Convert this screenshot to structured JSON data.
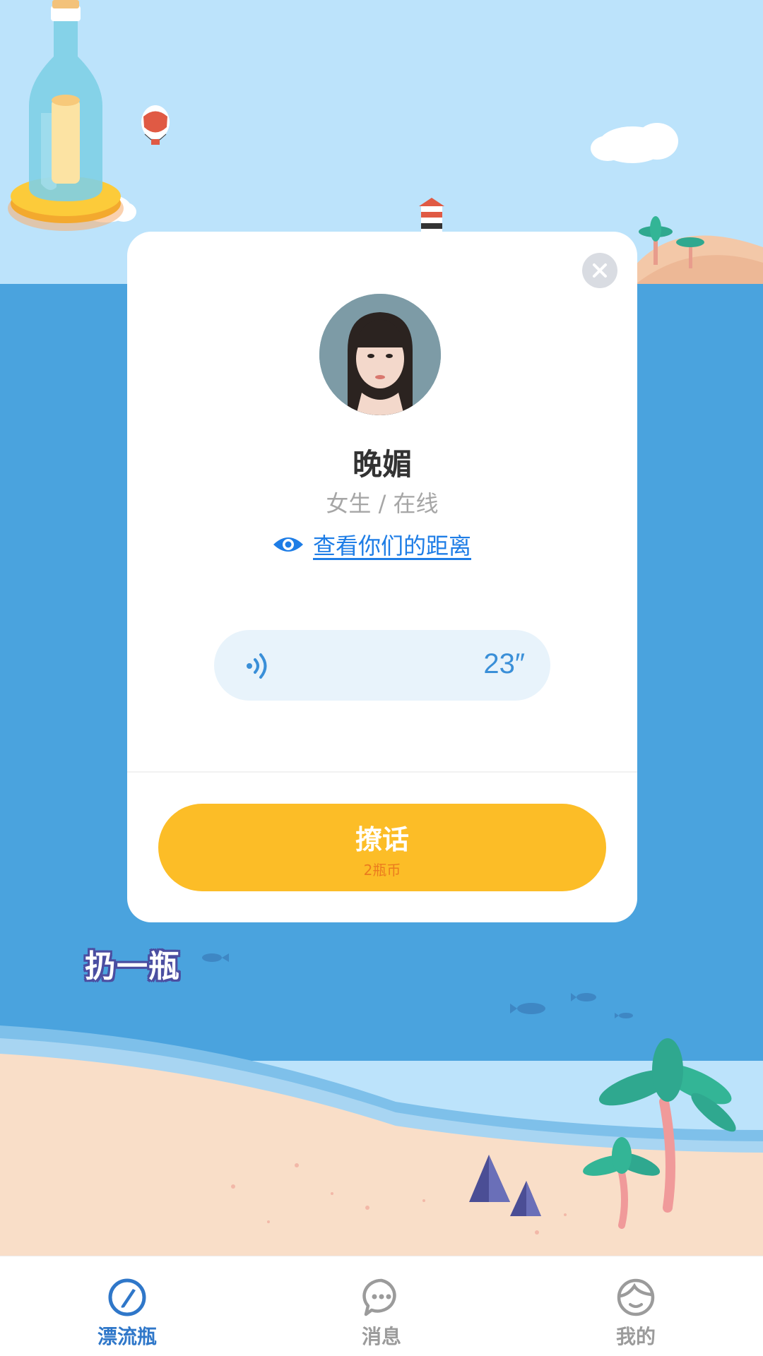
{
  "profile": {
    "name": "晚媚",
    "info": "女生 / 在线",
    "distance_link": "查看你们的距离"
  },
  "voice": {
    "duration": "23″"
  },
  "chat_button": {
    "label": "撩话",
    "cost": "2瓶币"
  },
  "scene": {
    "throw_label": "扔一瓶"
  },
  "tabbar": {
    "items": [
      {
        "label": "漂流瓶",
        "icon": "bottle-icon",
        "active": true
      },
      {
        "label": "消息",
        "icon": "message-icon",
        "active": false
      },
      {
        "label": "我的",
        "icon": "profile-icon",
        "active": false
      }
    ]
  },
  "colors": {
    "sky": "#BCE3FB",
    "sea": "#4AA3DE",
    "sand": "#F9DEC8",
    "accent_yellow": "#FCBD27",
    "link_blue": "#1E7DE6",
    "tab_active": "#2F77C9"
  }
}
